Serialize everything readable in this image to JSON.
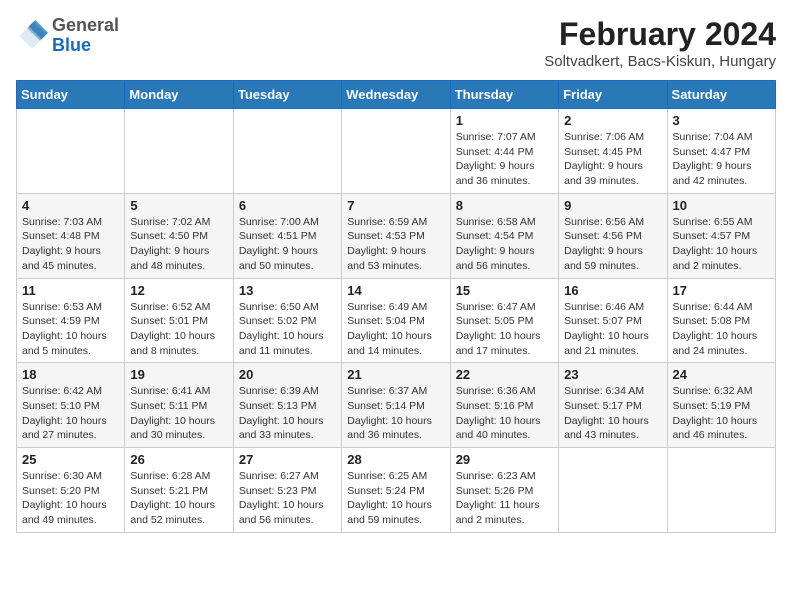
{
  "logo": {
    "general": "General",
    "blue": "Blue"
  },
  "header": {
    "title": "February 2024",
    "subtitle": "Soltvadkert, Bacs-Kiskun, Hungary"
  },
  "weekdays": [
    "Sunday",
    "Monday",
    "Tuesday",
    "Wednesday",
    "Thursday",
    "Friday",
    "Saturday"
  ],
  "weeks": [
    [
      {
        "day": "",
        "info": ""
      },
      {
        "day": "",
        "info": ""
      },
      {
        "day": "",
        "info": ""
      },
      {
        "day": "",
        "info": ""
      },
      {
        "day": "1",
        "info": "Sunrise: 7:07 AM\nSunset: 4:44 PM\nDaylight: 9 hours\nand 36 minutes."
      },
      {
        "day": "2",
        "info": "Sunrise: 7:06 AM\nSunset: 4:45 PM\nDaylight: 9 hours\nand 39 minutes."
      },
      {
        "day": "3",
        "info": "Sunrise: 7:04 AM\nSunset: 4:47 PM\nDaylight: 9 hours\nand 42 minutes."
      }
    ],
    [
      {
        "day": "4",
        "info": "Sunrise: 7:03 AM\nSunset: 4:48 PM\nDaylight: 9 hours\nand 45 minutes."
      },
      {
        "day": "5",
        "info": "Sunrise: 7:02 AM\nSunset: 4:50 PM\nDaylight: 9 hours\nand 48 minutes."
      },
      {
        "day": "6",
        "info": "Sunrise: 7:00 AM\nSunset: 4:51 PM\nDaylight: 9 hours\nand 50 minutes."
      },
      {
        "day": "7",
        "info": "Sunrise: 6:59 AM\nSunset: 4:53 PM\nDaylight: 9 hours\nand 53 minutes."
      },
      {
        "day": "8",
        "info": "Sunrise: 6:58 AM\nSunset: 4:54 PM\nDaylight: 9 hours\nand 56 minutes."
      },
      {
        "day": "9",
        "info": "Sunrise: 6:56 AM\nSunset: 4:56 PM\nDaylight: 9 hours\nand 59 minutes."
      },
      {
        "day": "10",
        "info": "Sunrise: 6:55 AM\nSunset: 4:57 PM\nDaylight: 10 hours\nand 2 minutes."
      }
    ],
    [
      {
        "day": "11",
        "info": "Sunrise: 6:53 AM\nSunset: 4:59 PM\nDaylight: 10 hours\nand 5 minutes."
      },
      {
        "day": "12",
        "info": "Sunrise: 6:52 AM\nSunset: 5:01 PM\nDaylight: 10 hours\nand 8 minutes."
      },
      {
        "day": "13",
        "info": "Sunrise: 6:50 AM\nSunset: 5:02 PM\nDaylight: 10 hours\nand 11 minutes."
      },
      {
        "day": "14",
        "info": "Sunrise: 6:49 AM\nSunset: 5:04 PM\nDaylight: 10 hours\nand 14 minutes."
      },
      {
        "day": "15",
        "info": "Sunrise: 6:47 AM\nSunset: 5:05 PM\nDaylight: 10 hours\nand 17 minutes."
      },
      {
        "day": "16",
        "info": "Sunrise: 6:46 AM\nSunset: 5:07 PM\nDaylight: 10 hours\nand 21 minutes."
      },
      {
        "day": "17",
        "info": "Sunrise: 6:44 AM\nSunset: 5:08 PM\nDaylight: 10 hours\nand 24 minutes."
      }
    ],
    [
      {
        "day": "18",
        "info": "Sunrise: 6:42 AM\nSunset: 5:10 PM\nDaylight: 10 hours\nand 27 minutes."
      },
      {
        "day": "19",
        "info": "Sunrise: 6:41 AM\nSunset: 5:11 PM\nDaylight: 10 hours\nand 30 minutes."
      },
      {
        "day": "20",
        "info": "Sunrise: 6:39 AM\nSunset: 5:13 PM\nDaylight: 10 hours\nand 33 minutes."
      },
      {
        "day": "21",
        "info": "Sunrise: 6:37 AM\nSunset: 5:14 PM\nDaylight: 10 hours\nand 36 minutes."
      },
      {
        "day": "22",
        "info": "Sunrise: 6:36 AM\nSunset: 5:16 PM\nDaylight: 10 hours\nand 40 minutes."
      },
      {
        "day": "23",
        "info": "Sunrise: 6:34 AM\nSunset: 5:17 PM\nDaylight: 10 hours\nand 43 minutes."
      },
      {
        "day": "24",
        "info": "Sunrise: 6:32 AM\nSunset: 5:19 PM\nDaylight: 10 hours\nand 46 minutes."
      }
    ],
    [
      {
        "day": "25",
        "info": "Sunrise: 6:30 AM\nSunset: 5:20 PM\nDaylight: 10 hours\nand 49 minutes."
      },
      {
        "day": "26",
        "info": "Sunrise: 6:28 AM\nSunset: 5:21 PM\nDaylight: 10 hours\nand 52 minutes."
      },
      {
        "day": "27",
        "info": "Sunrise: 6:27 AM\nSunset: 5:23 PM\nDaylight: 10 hours\nand 56 minutes."
      },
      {
        "day": "28",
        "info": "Sunrise: 6:25 AM\nSunset: 5:24 PM\nDaylight: 10 hours\nand 59 minutes."
      },
      {
        "day": "29",
        "info": "Sunrise: 6:23 AM\nSunset: 5:26 PM\nDaylight: 11 hours\nand 2 minutes."
      },
      {
        "day": "",
        "info": ""
      },
      {
        "day": "",
        "info": ""
      }
    ]
  ]
}
